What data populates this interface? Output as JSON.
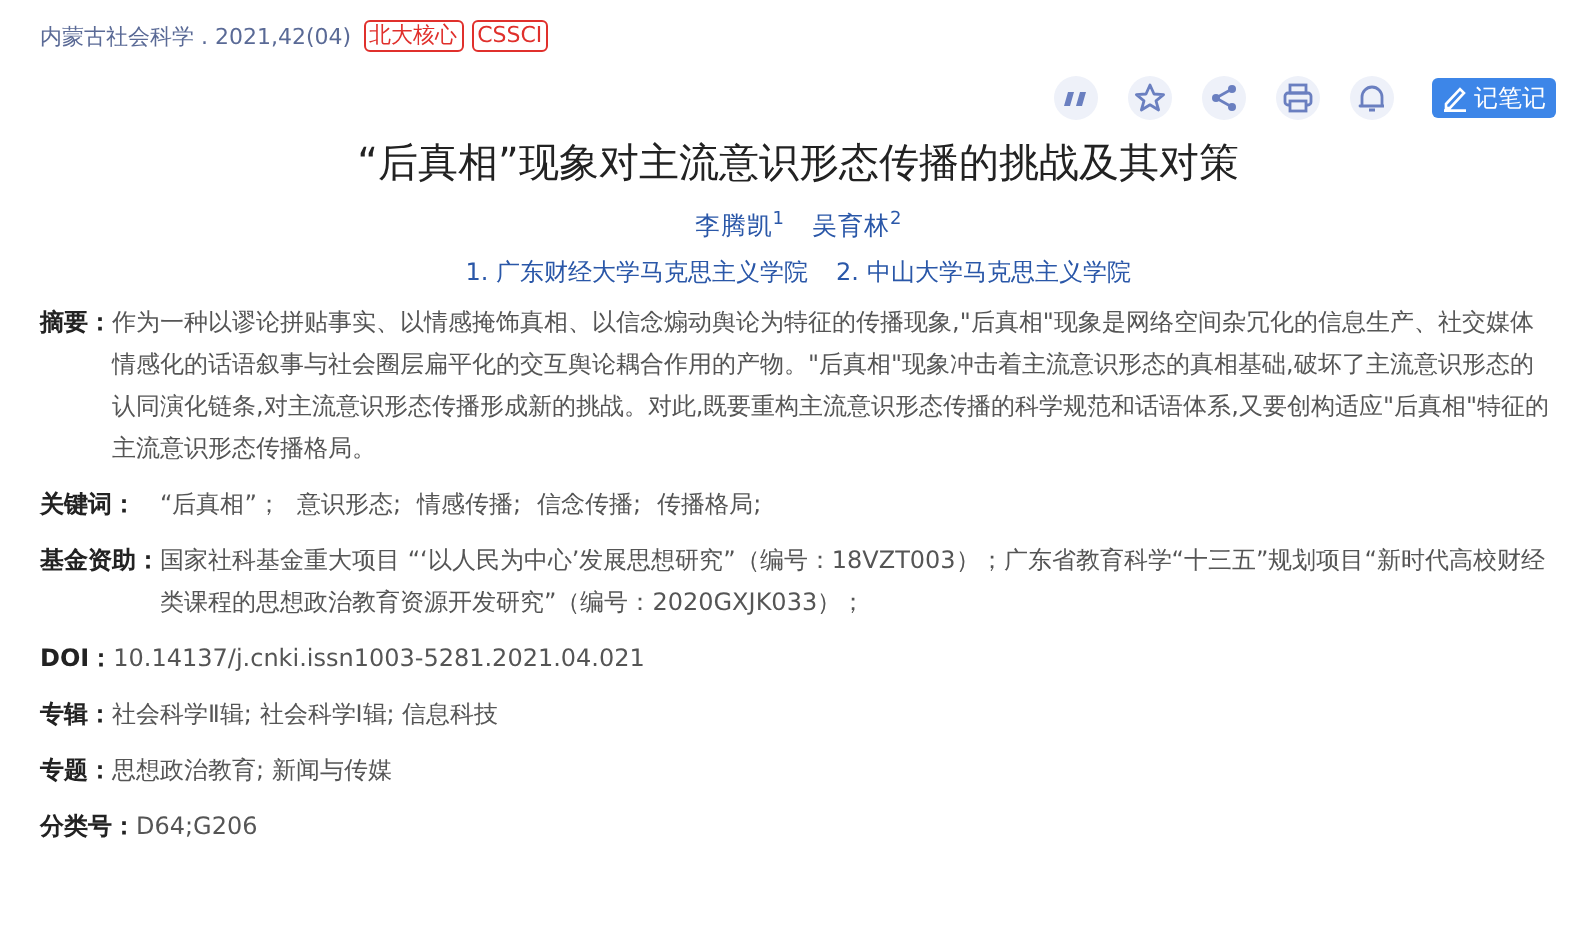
{
  "source": {
    "journal": "内蒙古社会科学 . 2021,42(04)",
    "badges": [
      "北大核心",
      "CSSCI"
    ]
  },
  "toolbar": {
    "note_button": "记笔记"
  },
  "title": "“后真相”现象对主流意识形态传播的挑战及其对策",
  "authors": [
    "李腾凯$^{1}$",
    "吴育林$^{2}$"
  ],
  "affiliations": [
    "1. 广东财经大学马克思主义学院",
    "2. 中山大学马克思主义学院"
  ],
  "fields": [
    {
      "kind": "text",
      "label": "摘要：",
      "value": "作为一种以谬论拼贴事实、以情感掩饰真相、以信念煽动舆论为特征的传播现象,\"后真相\"现象是网络空间杂冗化的信息生产、社交媒体情感化的话语叙事与社会圈层扁平化的交互舆论耦合作用的产物。\"后真相\"现象冲击着主流意识形态的真相基础,破坏了主流意识形态的认同演化链条,对主流意识形态传播形成新的挑战。对此,既要重构主流意识形态传播的科学规范和话语体系,又要创构适应\"后真相\"特征的主流意识形态传播格局。"
    },
    {
      "kind": "list",
      "label": "关键词：",
      "items": [
        "“后真相”；",
        "意识形态;",
        "情感传播;",
        "信念传播;",
        "传播格局;"
      ]
    },
    {
      "kind": "text",
      "label": "基金资助：",
      "value": "国家社科基金重大项目 “‘以人民为中心’发展思想研究”（编号：18VZT003）；广东省教育科学“十三五”规划项目“新时代高校财经类课程的思想政治教育资源开发研究”（编号：2020GXJK033）；"
    },
    {
      "kind": "text",
      "label": "DOI：",
      "value": "10.14137/j.cnki.issn1003-5281.2021.04.021"
    },
    {
      "kind": "text",
      "label": "专辑：",
      "value": "社会科学Ⅱ辑; 社会科学Ⅰ辑; 信息科技"
    },
    {
      "kind": "text",
      "label": "专题：",
      "value": "思想政治教育; 新闻与传媒"
    },
    {
      "kind": "text",
      "label": "分类号：",
      "value": "D64;G206"
    }
  ]
}
